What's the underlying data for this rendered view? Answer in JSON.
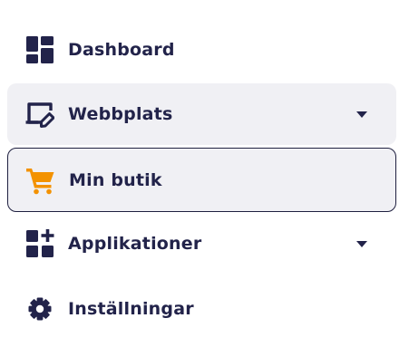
{
  "nav": {
    "items": [
      {
        "label": "Dashboard",
        "icon": "dashboard-grid-icon"
      },
      {
        "label": "Webbplats",
        "icon": "website-edit-icon",
        "expandable": true
      },
      {
        "label": "Min butik",
        "icon": "shopping-cart-icon",
        "selected": true
      },
      {
        "label": "Applikationer",
        "icon": "apps-add-icon",
        "expandable": true
      },
      {
        "label": "Inställningar",
        "icon": "gear-icon"
      }
    ]
  },
  "colors": {
    "text": "#22234a",
    "icon": "#22234a",
    "cart_icon": "#f39200",
    "item_bg": "#f0f0f4",
    "selected_border": "#1f2040"
  }
}
